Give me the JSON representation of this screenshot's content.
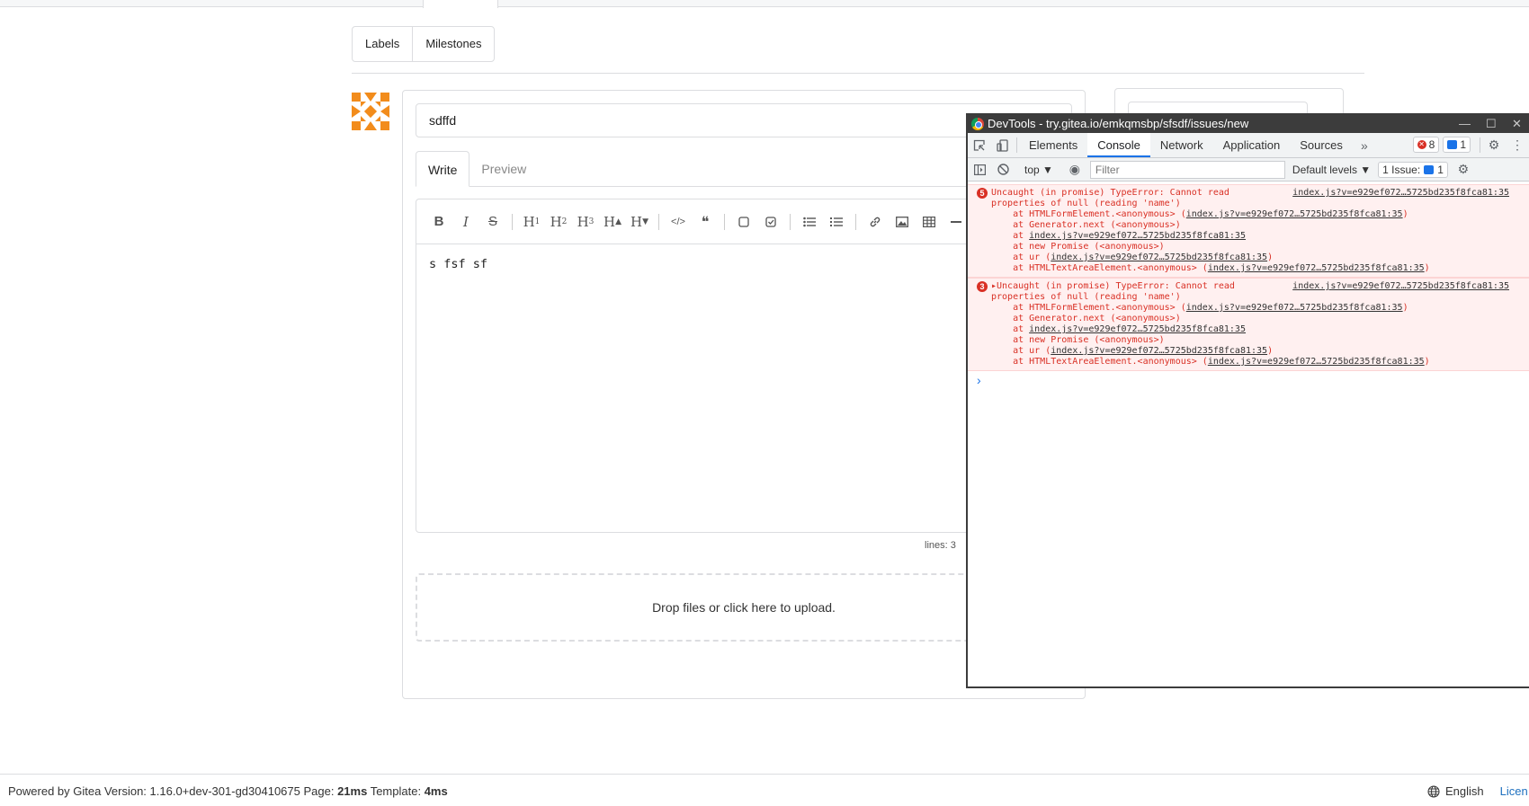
{
  "labels_btn": "Labels",
  "milestones_btn": "Milestones",
  "title_value": "sdffd",
  "tabs": {
    "write": "Write",
    "preview": "Preview"
  },
  "toolbar": {
    "bold": "B",
    "italic": "I",
    "strike": "S",
    "h1": "H",
    "h2": "H",
    "h3": "H",
    "h4": "H",
    "h5": "H",
    "h1s": "1",
    "h2s": "2",
    "h3s": "3",
    "h4s": "▲",
    "h5s": "▼",
    "code": "</>",
    "quote": "❝"
  },
  "editor_text": "s fsf sf",
  "lines_count": "lines: 3",
  "dropzone_text": "Drop files or click here to upload.",
  "footer": {
    "powered": "Powered by Gitea Version: 1.16.0+dev-301-gd30410675 Page: ",
    "page_time": "21ms",
    "template_label": " Template: ",
    "template_time": "4ms",
    "language": "English",
    "licenses": "Licen"
  },
  "devtools": {
    "title": "DevTools - try.gitea.io/emkqmsbp/sfsdf/issues/new",
    "tabs": [
      "Elements",
      "Console",
      "Network",
      "Application",
      "Sources"
    ],
    "error_count": "8",
    "message_count": "1",
    "context": "top ▼",
    "filter_placeholder": "Filter",
    "levels": "Default levels ▼",
    "issues_label": "1 Issue:",
    "issues_count": "1",
    "errors": [
      {
        "count": "5",
        "head": "Uncaught (in promise) TypeError: Cannot read",
        "source": "index.js?v=e929ef072…5725bd235f8fca81:35",
        "l1": "properties of null (reading 'name')",
        "l2a": "    at HTMLFormElement.<anonymous> (",
        "l2b": "index.js?v=e929ef072…5725bd235f8fca81:35",
        "l2c": ")",
        "l3": "    at Generator.next (<anonymous>)",
        "l4a": "    at ",
        "l4b": "index.js?v=e929ef072…5725bd235f8fca81:35",
        "l5": "    at new Promise (<anonymous>)",
        "l6a": "    at ur (",
        "l6b": "index.js?v=e929ef072…5725bd235f8fca81:35",
        "l6c": ")",
        "l7a": "    at HTMLTextAreaElement.<anonymous> (",
        "l7b": "index.js?v=e929ef072…5725bd235f8fca81:35",
        "l7c": ")"
      },
      {
        "count": "3",
        "head": "▸Uncaught (in promise) TypeError: Cannot read",
        "source": "index.js?v=e929ef072…5725bd235f8fca81:35",
        "l1": "properties of null (reading 'name')",
        "l2a": "    at HTMLFormElement.<anonymous> (",
        "l2b": "index.js?v=e929ef072…5725bd235f8fca81:35",
        "l2c": ")",
        "l3": "    at Generator.next (<anonymous>)",
        "l4a": "    at ",
        "l4b": "index.js?v=e929ef072…5725bd235f8fca81:35",
        "l5": "    at new Promise (<anonymous>)",
        "l6a": "    at ur (",
        "l6b": "index.js?v=e929ef072…5725bd235f8fca81:35",
        "l6c": ")",
        "l7a": "    at HTMLTextAreaElement.<anonymous> (",
        "l7b": "index.js?v=e929ef072…5725bd235f8fca81:35",
        "l7c": ")"
      }
    ],
    "prompt": "›"
  },
  "colors": {
    "accent": "#1e70bf",
    "error": "#d93025",
    "avatar": "#f28c1c"
  }
}
